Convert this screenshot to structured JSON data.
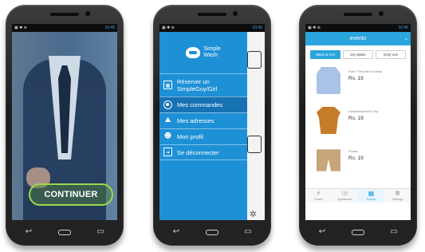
{
  "status_bar": {
    "time": "10:45"
  },
  "screen1": {
    "continue_label": "CONTINUER"
  },
  "screen2": {
    "logo_text_1": "Simple",
    "logo_text_2": "Wash",
    "menu": [
      {
        "label_line1": "Réserver un",
        "label_line2": "SimpleGuy/Girl",
        "icon": "calendar-icon"
      },
      {
        "label": "Mes commandes",
        "icon": "target-icon",
        "active": true
      },
      {
        "label": "Mes adresses",
        "icon": "map-icon"
      },
      {
        "label": "Mon profil",
        "icon": "users-icon"
      },
      {
        "label": "Se déconnecter",
        "icon": "logout-icon"
      }
    ]
  },
  "screen3": {
    "header_title": "events",
    "tabs": [
      "Wash & Iron",
      "Dry Wash",
      "Only Iron"
    ],
    "items": [
      {
        "name": "Shirt / Tee-shirt / Kurtha",
        "price": "Rs. 19"
      },
      {
        "name": "Salwar/Women's Top",
        "price": "Rs. 19"
      },
      {
        "name": "Shorts",
        "price": "Rs. 19"
      }
    ],
    "nav": [
      "Power",
      "Appliances",
      "Events",
      "Settings"
    ]
  },
  "android_nav": {
    "back": "back-icon",
    "home": "home-icon",
    "recents": "recents-icon"
  }
}
